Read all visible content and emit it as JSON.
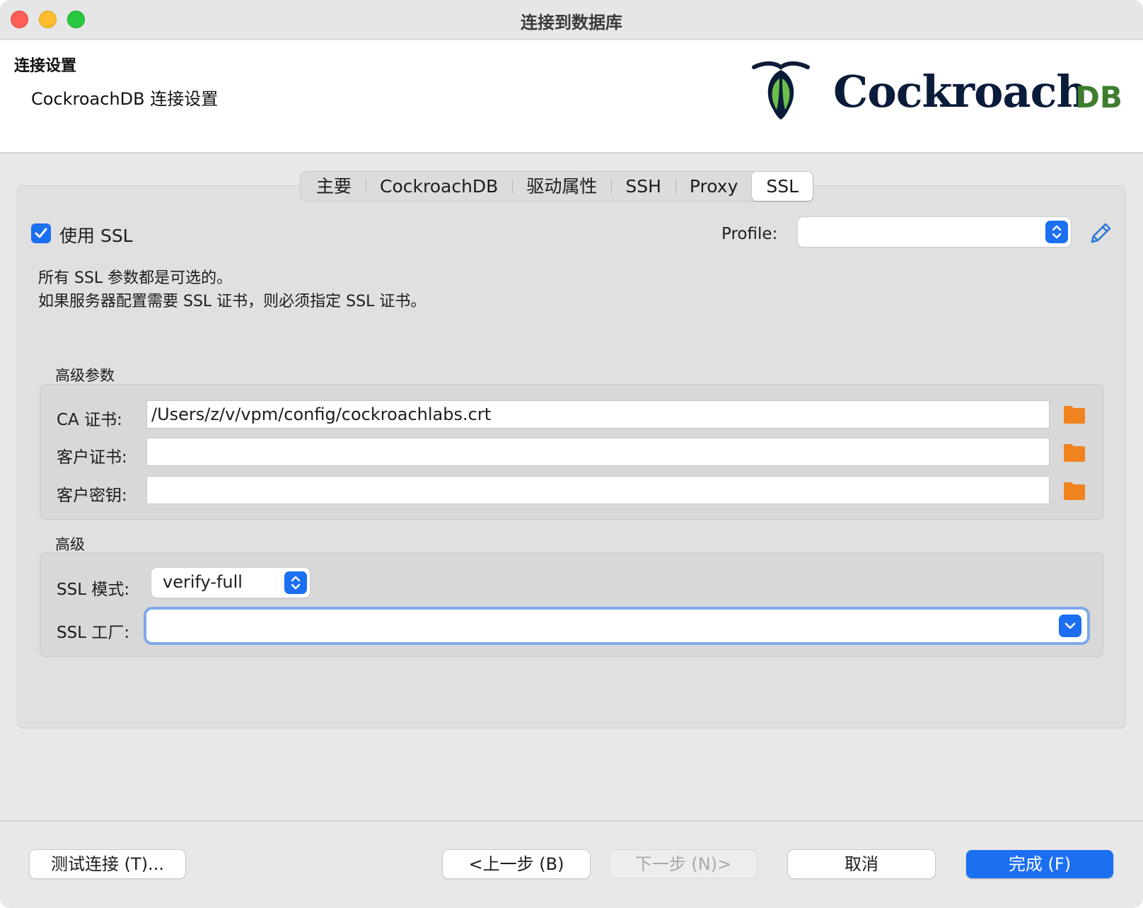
{
  "window": {
    "title": "连接到数据库"
  },
  "header": {
    "title": "连接设置",
    "subtitle": "CockroachDB 连接设置",
    "logo_text": "Cockroach",
    "logo_suffix": "DB"
  },
  "tabs": [
    {
      "label": "主要",
      "active": false
    },
    {
      "label": "CockroachDB",
      "active": false
    },
    {
      "label": "驱动属性",
      "active": false
    },
    {
      "label": "SSH",
      "active": false
    },
    {
      "label": "Proxy",
      "active": false
    },
    {
      "label": "SSL",
      "active": true
    }
  ],
  "ssl": {
    "use_ssl_label": "使用 SSL",
    "use_ssl_checked": true,
    "profile_label": "Profile:",
    "profile_value": "",
    "info_line1": "所有 SSL 参数都是可选的。",
    "info_line2": "如果服务器配置需要 SSL 证书，则必须指定 SSL 证书。"
  },
  "advanced_params": {
    "label": "高级参数",
    "ca_cert_label": "CA 证书:",
    "ca_cert_value": "/Users/z/v/vpm/config/cockroachlabs.crt",
    "client_cert_label": "客户证书:",
    "client_cert_value": "",
    "client_key_label": "客户密钥:",
    "client_key_value": ""
  },
  "advanced": {
    "label": "高级",
    "ssl_mode_label": "SSL 模式:",
    "ssl_mode_value": "verify-full",
    "ssl_factory_label": "SSL 工厂:",
    "ssl_factory_value": ""
  },
  "footer": {
    "test_button": "测试连接 (T)...",
    "back_button": "<上一步 (B)",
    "next_button": "下一步 (N)>",
    "cancel_button": "取消",
    "finish_button": "完成 (F)"
  },
  "colors": {
    "accent": "#1d6ff2",
    "folder": "#f0831e",
    "logo_navy": "#0b1c3a",
    "logo_green": "#3e7e2e"
  }
}
